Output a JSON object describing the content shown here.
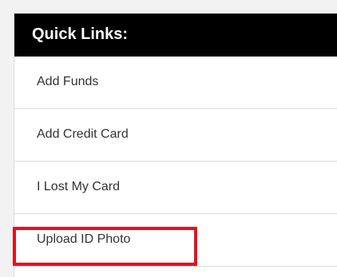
{
  "quick_links": {
    "title": "Quick Links:",
    "items": [
      {
        "label": "Add Funds"
      },
      {
        "label": "Add Credit Card"
      },
      {
        "label": "I Lost My Card"
      },
      {
        "label": "Upload ID Photo",
        "highlighted": true
      }
    ]
  },
  "colors": {
    "header_background": "#000000",
    "header_text": "#ffffff",
    "link_text": "#333333",
    "divider": "#dcdcdc",
    "highlight_border": "#e4111f"
  }
}
